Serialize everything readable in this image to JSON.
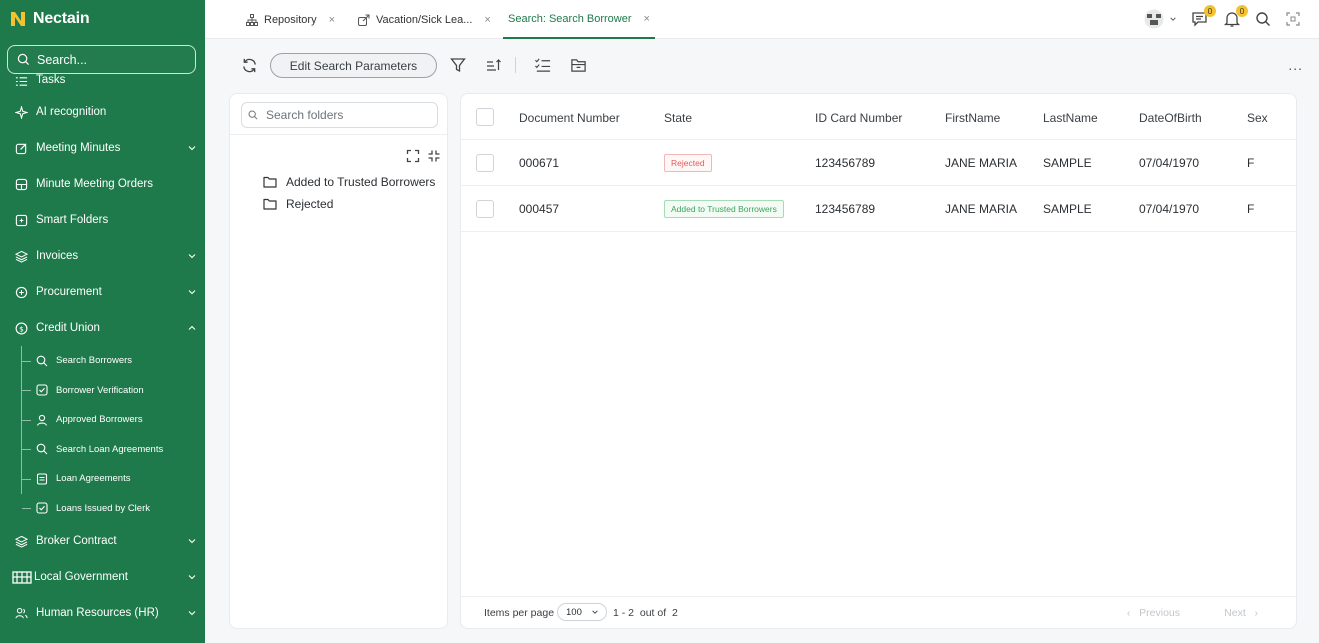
{
  "brand": {
    "name": "Nectain",
    "color": "#1f7a4b",
    "mark_color": "#f2c230"
  },
  "sidebar": {
    "search_placeholder": "Search...",
    "items": [
      {
        "label": "Tasks",
        "icon": "tasks-icon"
      },
      {
        "label": "AI recognition",
        "icon": "sparkle-icon"
      },
      {
        "label": "Meeting Minutes",
        "icon": "edit-icon",
        "chevron": "down"
      },
      {
        "label": "Minute Meeting Orders",
        "icon": "grid-icon"
      },
      {
        "label": "Smart Folders",
        "icon": "smart-folder-icon"
      },
      {
        "label": "Invoices",
        "icon": "layers-icon",
        "chevron": "down"
      },
      {
        "label": "Procurement",
        "icon": "procurement-icon",
        "chevron": "down"
      },
      {
        "label": "Credit Union",
        "icon": "dollar-icon",
        "chevron": "up"
      }
    ],
    "credit_union_sub": [
      {
        "label": "Search Borrowers",
        "icon": "search-icon"
      },
      {
        "label": "Borrower Verification",
        "icon": "verify-icon"
      },
      {
        "label": "Approved Borrowers",
        "icon": "user-icon"
      },
      {
        "label": "Search Loan Agreements",
        "icon": "search-icon"
      },
      {
        "label": "Loan Agreements",
        "icon": "document-icon"
      },
      {
        "label": "Loans Issued by Clerk",
        "icon": "verify-icon"
      }
    ],
    "items_after": [
      {
        "label": "Broker Contract",
        "icon": "layers-icon",
        "chevron": "down"
      },
      {
        "label": "Local Government",
        "icon": "building-icon",
        "chevron": "down"
      },
      {
        "label": "Human Resources (HR)",
        "icon": "people-icon",
        "chevron": "down"
      }
    ]
  },
  "tabs": [
    {
      "label": "Repository",
      "close": "×"
    },
    {
      "label": "Vacation/Sick Lea...",
      "close": "×"
    },
    {
      "label": "Search: Search Borrower",
      "close": "×"
    }
  ],
  "top_badges": {
    "messages": "0",
    "notifications": "0"
  },
  "toolbar": {
    "edit_label": "Edit Search Parameters",
    "more": "..."
  },
  "folders": {
    "search_placeholder": "Search folders",
    "items": [
      "Added to Trusted Borrowers",
      "Rejected"
    ]
  },
  "table": {
    "columns": [
      "Document Number",
      "State",
      "ID Card Number",
      "FirstName",
      "LastName",
      "DateOfBirth",
      "Sex"
    ],
    "rows": [
      {
        "doc": "000671",
        "state": "Rejected",
        "state_kind": "rejected",
        "id_card": "123456789",
        "first": "JANE MARIA",
        "last": "SAMPLE",
        "dob": "07/04/1970",
        "sex": "F"
      },
      {
        "doc": "000457",
        "state": "Added to Trusted Borrowers",
        "state_kind": "trusted",
        "id_card": "123456789",
        "first": "JANE MARIA",
        "last": "SAMPLE",
        "dob": "07/04/1970",
        "sex": "F"
      }
    ]
  },
  "pager": {
    "items_per_page_label": "Items per page",
    "per_page": "100",
    "range": "1 - 2",
    "out_of_label": "out of",
    "total": "2",
    "prev_label": "Previous",
    "next_label": "Next"
  }
}
